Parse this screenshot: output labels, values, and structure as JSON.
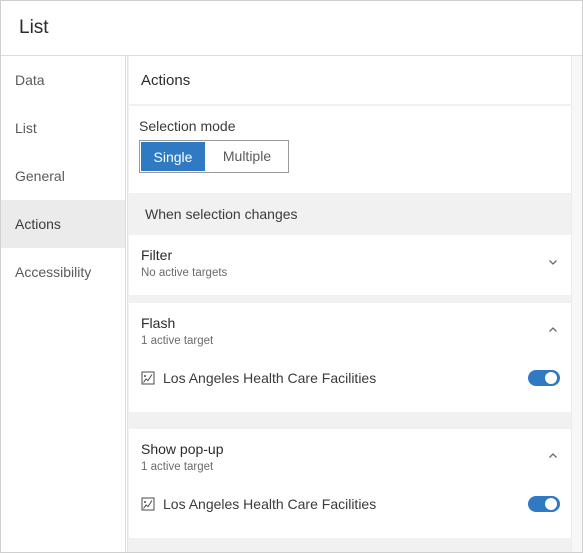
{
  "window": {
    "title": "List"
  },
  "sidebar": {
    "items": [
      {
        "label": "Data"
      },
      {
        "label": "List"
      },
      {
        "label": "General"
      },
      {
        "label": "Actions"
      },
      {
        "label": "Accessibility"
      }
    ],
    "active": "Actions"
  },
  "panel": {
    "title": "Actions",
    "selection_mode": {
      "label": "Selection mode",
      "options": [
        "Single",
        "Multiple"
      ],
      "selected": "Single"
    },
    "when_selection_changes": "When selection changes",
    "actions": [
      {
        "title": "Filter",
        "subtitle": "No active targets",
        "expanded": false,
        "targets": []
      },
      {
        "title": "Flash",
        "subtitle": "1 active target",
        "expanded": true,
        "targets": [
          {
            "label": "Los Angeles Health Care Facilities",
            "enabled": true
          }
        ]
      },
      {
        "title": "Show pop-up",
        "subtitle": "1 active target",
        "expanded": true,
        "targets": [
          {
            "label": "Los Angeles Health Care Facilities",
            "enabled": true
          }
        ]
      }
    ]
  },
  "colors": {
    "accent": "#2f7ac2",
    "active_nav_bg": "#ebebeb",
    "panel_bg": "#f1f1f1"
  },
  "icons": {
    "chevron_collapsed": "chevron-down-icon",
    "chevron_expanded": "chevron-up-icon",
    "layer": "feature-layer-icon"
  }
}
